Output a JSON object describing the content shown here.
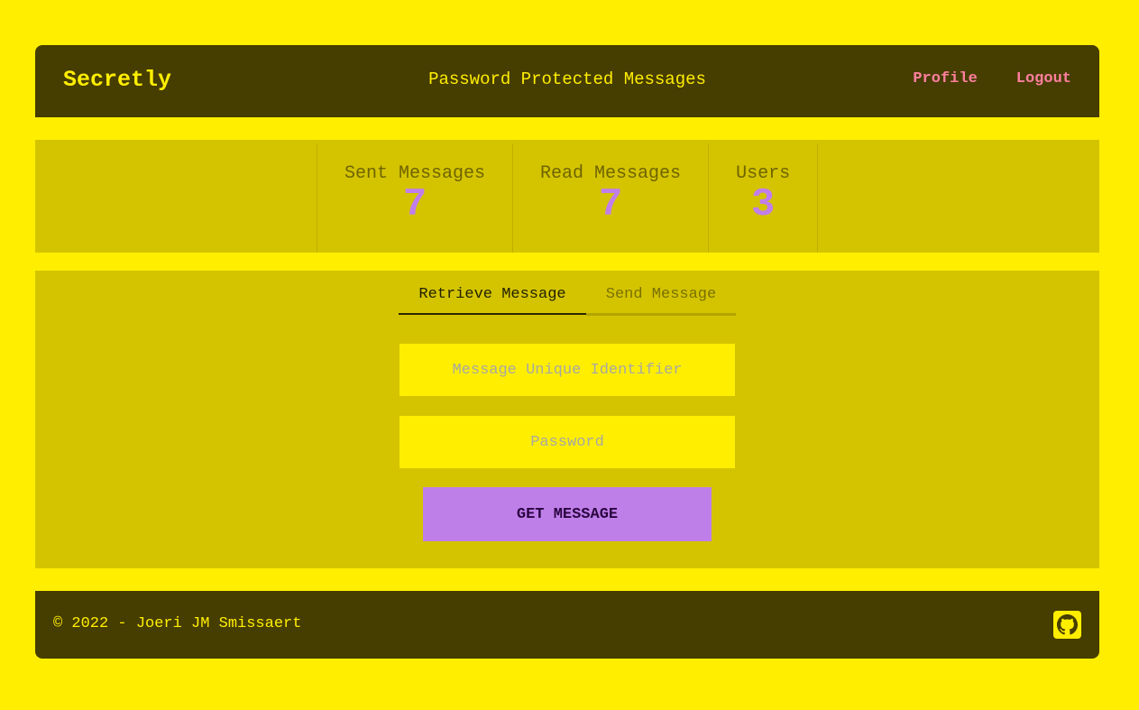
{
  "header": {
    "brand": "Secretly",
    "tagline": "Password Protected Messages",
    "links": [
      {
        "label": "Profile"
      },
      {
        "label": "Logout"
      }
    ]
  },
  "stats": [
    {
      "title": "Sent Messages",
      "value": "7"
    },
    {
      "title": "Read Messages",
      "value": "7"
    },
    {
      "title": "Users",
      "value": "3"
    }
  ],
  "tabs": [
    {
      "label": "Retrieve Message",
      "active": true
    },
    {
      "label": "Send Message",
      "active": false
    }
  ],
  "form": {
    "identifier_placeholder": "Message Unique Identifier",
    "identifier_value": "",
    "password_placeholder": "Password",
    "password_value": "",
    "submit_label": "GET MESSAGE"
  },
  "footer": {
    "copyright": "© 2022 - Joeri JM Smissaert",
    "icon": "github-icon"
  },
  "colors": {
    "page_background": "#ffee00",
    "bar_background": "#463d00",
    "panel_background": "#d4c400",
    "accent": "#bf7fe9",
    "link": "#ff7f9f"
  }
}
